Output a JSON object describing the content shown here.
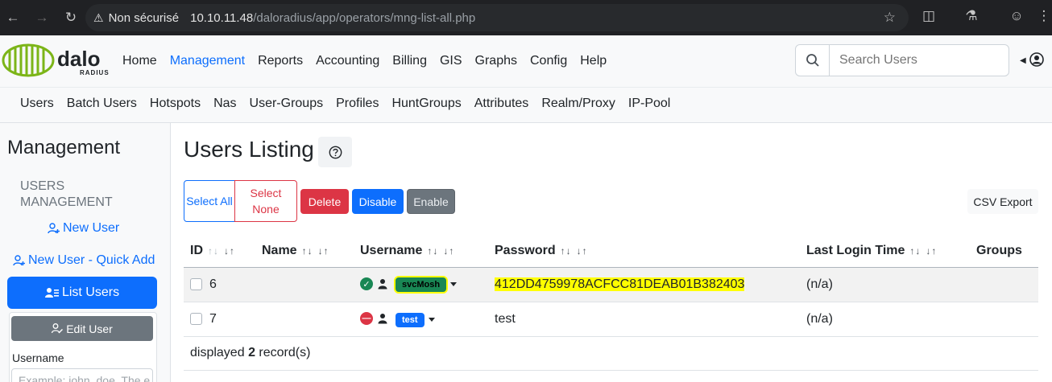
{
  "browser": {
    "security_label": "Non sécurisé",
    "url_host": "10.10.11.48",
    "url_path": "/daloradius/app/operators/mng-list-all.php"
  },
  "brand": {
    "name_top": "dalo",
    "name_bottom": "RADIUS",
    "accent": "#7cb518"
  },
  "topnav": {
    "items": [
      "Home",
      "Management",
      "Reports",
      "Accounting",
      "Billing",
      "GIS",
      "Graphs",
      "Config",
      "Help"
    ],
    "active": "Management"
  },
  "search": {
    "placeholder": "Search Users"
  },
  "subnav": {
    "items": [
      "Users",
      "Batch Users",
      "Hotspots",
      "Nas",
      "User-Groups",
      "Profiles",
      "HuntGroups",
      "Attributes",
      "Realm/Proxy",
      "IP-Pool"
    ]
  },
  "sidebar": {
    "title": "Management",
    "section": "USERS MANAGEMENT",
    "new_user": "New User",
    "new_user_quick": "New User - Quick Add",
    "list_users": "List Users",
    "edit_user": "Edit User",
    "username_label": "Username",
    "username_placeholder": "Example: john_doe, The e"
  },
  "main": {
    "title": "Users Listing",
    "buttons": {
      "select_all": "Select All",
      "select_none": "Select None",
      "delete": "Delete",
      "disable": "Disable",
      "enable": "Enable",
      "csv_export": "CSV Export"
    },
    "columns": [
      "ID",
      "Name",
      "Username",
      "Password",
      "Last Login Time",
      "Groups"
    ],
    "rows": [
      {
        "id": "6",
        "name": "",
        "username": "svcMosh",
        "password": "412DD4759978ACFCC81DEAB01B382403",
        "last_login": "(n/a)",
        "groups": "",
        "status": "enabled"
      },
      {
        "id": "7",
        "name": "",
        "username": "test",
        "password": "test",
        "last_login": "(n/a)",
        "groups": "",
        "status": "disabled"
      }
    ],
    "footer_prefix": "displayed",
    "footer_count": "2",
    "footer_suffix": "record(s)"
  },
  "colors": {
    "primary": "#0d6efd",
    "danger": "#dc3545",
    "secondary": "#6c757d",
    "success": "#198754",
    "highlight": "#ffff00"
  }
}
